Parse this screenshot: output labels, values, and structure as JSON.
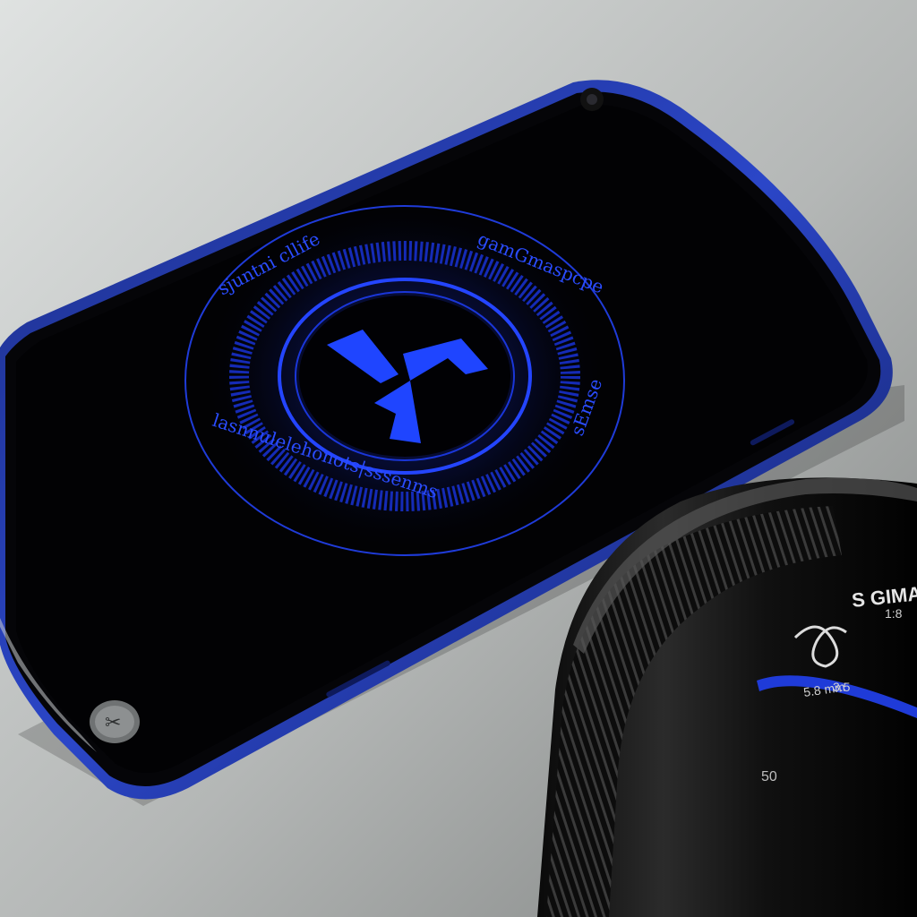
{
  "scene": {
    "description_tags": [
      "smartphone",
      "camera-lens",
      "product-render"
    ],
    "colors": {
      "accent": "#1f45ff",
      "accent_dark": "#0b1f8a",
      "screen": "#030306",
      "frame": "#1a2f9c",
      "lens_body": "#141414",
      "background": "#b9bcbb"
    }
  },
  "phone": {
    "ring_label_top_left": "sjuntni cllife",
    "ring_label_top_right": "gamGmaspcpe",
    "ring_label_right": "sEmse",
    "ring_label_bottom": "lasnnulelehonots|sssenms",
    "logo_icon": "stylized-blue-arrows-icon",
    "home_button_icon": "scissors-icon"
  },
  "lens": {
    "brand_text": "S GIMA",
    "logo_icon": "infinity-ribbon-icon",
    "marking_1": "5.8 mm",
    "marking_2": "3.5",
    "marking_3": "50",
    "marking_4": "1:8"
  }
}
